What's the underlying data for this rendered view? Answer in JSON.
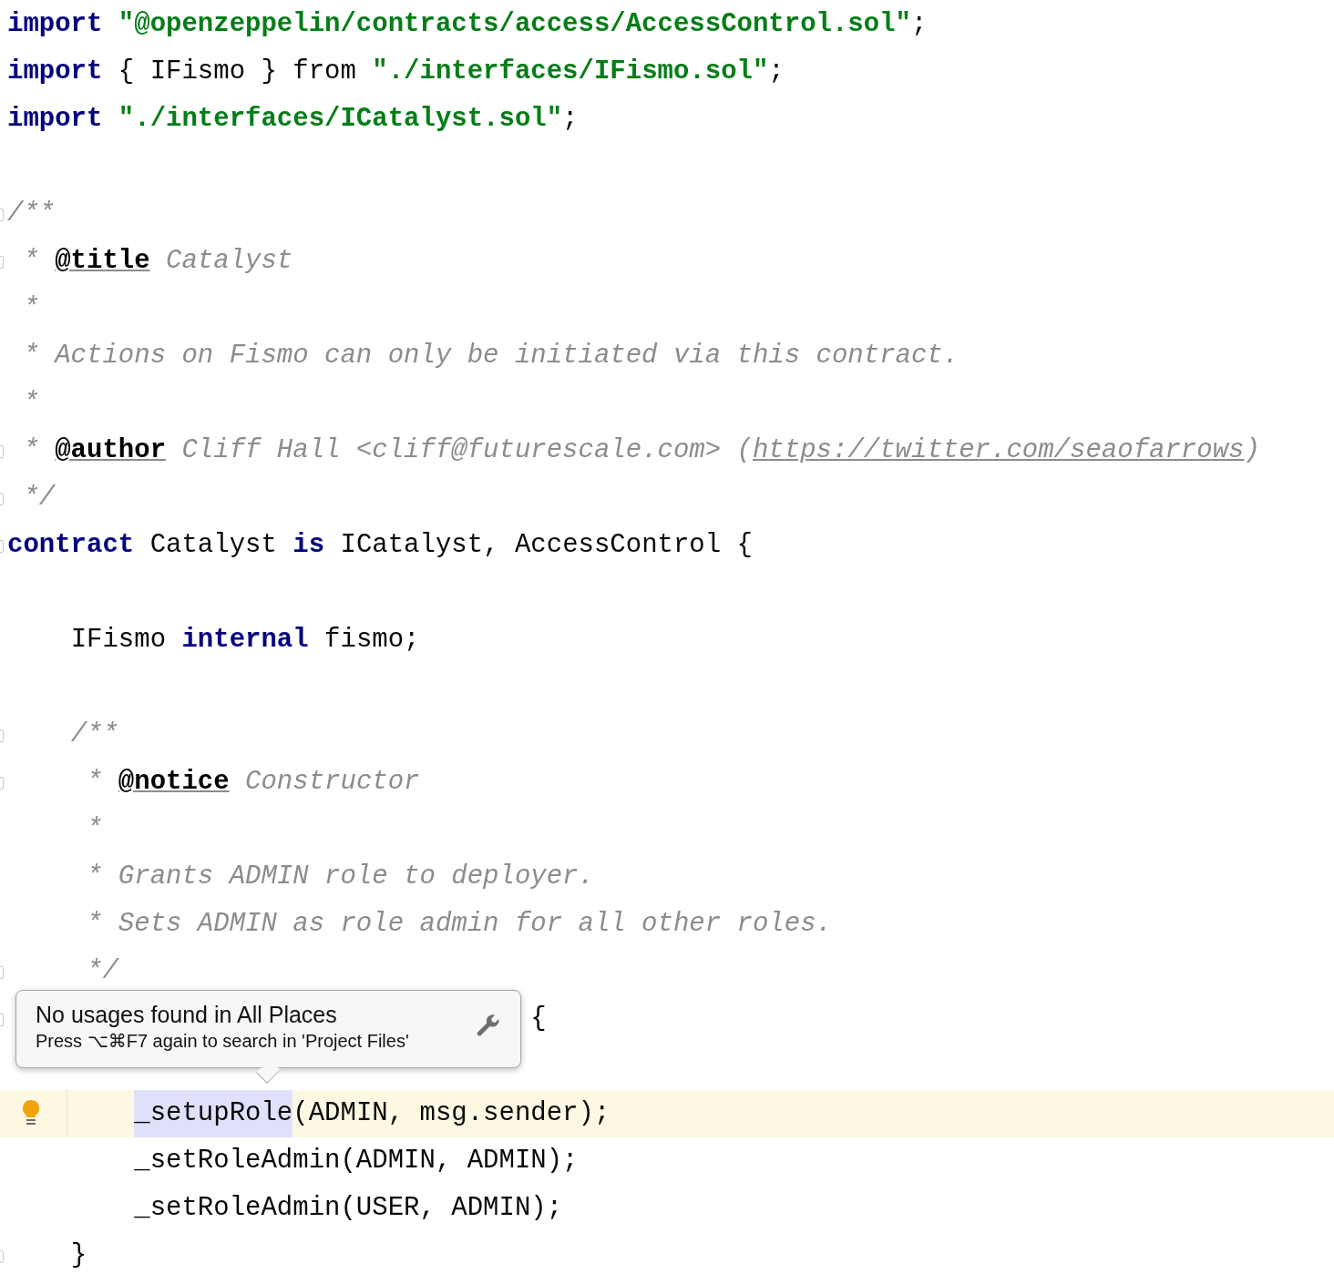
{
  "editor": {
    "blocks": [
      {
        "lines": [
          {
            "tokens": [
              {
                "kind": "keyword",
                "text": "import"
              },
              {
                "kind": "string",
                "text": " \"@openzeppelin/contracts/access/AccessControl.sol\""
              },
              {
                "kind": "plain",
                "text": ";"
              }
            ]
          },
          {
            "tokens": [
              {
                "kind": "keyword",
                "text": "import"
              },
              {
                "kind": "plain",
                "text": " { IFismo } from "
              },
              {
                "kind": "string",
                "text": "\"./interfaces/IFismo.sol\""
              },
              {
                "kind": "plain",
                "text": ";"
              }
            ]
          },
          {
            "tokens": [
              {
                "kind": "keyword",
                "text": "import"
              },
              {
                "kind": "string",
                "text": " \"./interfaces/ICatalyst.sol\""
              },
              {
                "kind": "plain",
                "text": ";"
              }
            ]
          }
        ]
      },
      {
        "lines": [
          {
            "fold": true,
            "tokens": [
              {
                "kind": "comment",
                "text": "/**"
              }
            ]
          },
          {
            "fold": true,
            "tokens": [
              {
                "kind": "comment",
                "text": " * "
              },
              {
                "kind": "tag",
                "text": "@title"
              },
              {
                "kind": "comment",
                "text": " Catalyst"
              }
            ]
          },
          {
            "tokens": [
              {
                "kind": "comment",
                "text": " *"
              }
            ]
          },
          {
            "tokens": [
              {
                "kind": "comment",
                "text": " * Actions on Fismo can only be initiated via this contract."
              }
            ]
          },
          {
            "tokens": [
              {
                "kind": "comment",
                "text": " *"
              }
            ]
          },
          {
            "fold": true,
            "tokens": [
              {
                "kind": "comment",
                "text": " * "
              },
              {
                "kind": "tag",
                "text": "@author"
              },
              {
                "kind": "comment",
                "text": " Cliff Hall <cliff@futurescale.com> ("
              },
              {
                "kind": "link",
                "text": "https://twitter.com/seaofarrows"
              },
              {
                "kind": "comment",
                "text": ")"
              }
            ]
          },
          {
            "fold": true,
            "tokens": [
              {
                "kind": "comment",
                "text": " */"
              }
            ]
          },
          {
            "fold": true,
            "tokens": [
              {
                "kind": "keyword",
                "text": "contract"
              },
              {
                "kind": "plain",
                "text": " Catalyst "
              },
              {
                "kind": "keyword",
                "text": "is"
              },
              {
                "kind": "plain",
                "text": " ICatalyst, AccessControl {"
              }
            ]
          }
        ]
      },
      {
        "lines": [
          {
            "tokens": [
              {
                "kind": "plain",
                "text": "    IFismo "
              },
              {
                "kind": "keyword",
                "text": "internal"
              },
              {
                "kind": "plain",
                "text": " fismo;"
              }
            ]
          }
        ]
      },
      {
        "lines": [
          {
            "fold": true,
            "tokens": [
              {
                "kind": "comment",
                "text": "    /**"
              }
            ]
          },
          {
            "fold": true,
            "tokens": [
              {
                "kind": "comment",
                "text": "     * "
              },
              {
                "kind": "tag",
                "text": "@notice"
              },
              {
                "kind": "comment",
                "text": " Constructor"
              }
            ]
          },
          {
            "tokens": [
              {
                "kind": "comment",
                "text": "     *"
              }
            ]
          },
          {
            "tokens": [
              {
                "kind": "comment",
                "text": "     * Grants ADMIN role to deployer."
              }
            ]
          },
          {
            "tokens": [
              {
                "kind": "comment",
                "text": "     * Sets ADMIN as role admin for all other roles."
              }
            ]
          },
          {
            "fold": true,
            "tokens": [
              {
                "kind": "comment",
                "text": "     */"
              }
            ]
          },
          {
            "fold": true,
            "tokens": [
              {
                "kind": "plain",
                "text": "                                 {"
              }
            ]
          }
        ]
      },
      {
        "lines": [
          {
            "current": true,
            "bulb": true,
            "tokens": [
              {
                "kind": "usage",
                "text": "        _setupRole"
              },
              {
                "kind": "plain",
                "text": "(ADMIN, msg.sender);"
              }
            ]
          },
          {
            "tokens": [
              {
                "kind": "plain",
                "text": "        _setRoleAdmin(ADMIN, ADMIN);"
              }
            ]
          },
          {
            "tokens": [
              {
                "kind": "plain",
                "text": "        _setRoleAdmin(USER, ADMIN);"
              }
            ]
          },
          {
            "fold": true,
            "tokens": [
              {
                "kind": "plain",
                "text": "    }"
              }
            ]
          }
        ]
      }
    ]
  },
  "tooltip": {
    "title": "No usages found in All Places",
    "hint": "Press ⌥⌘F7 again to search in 'Project Files'"
  }
}
